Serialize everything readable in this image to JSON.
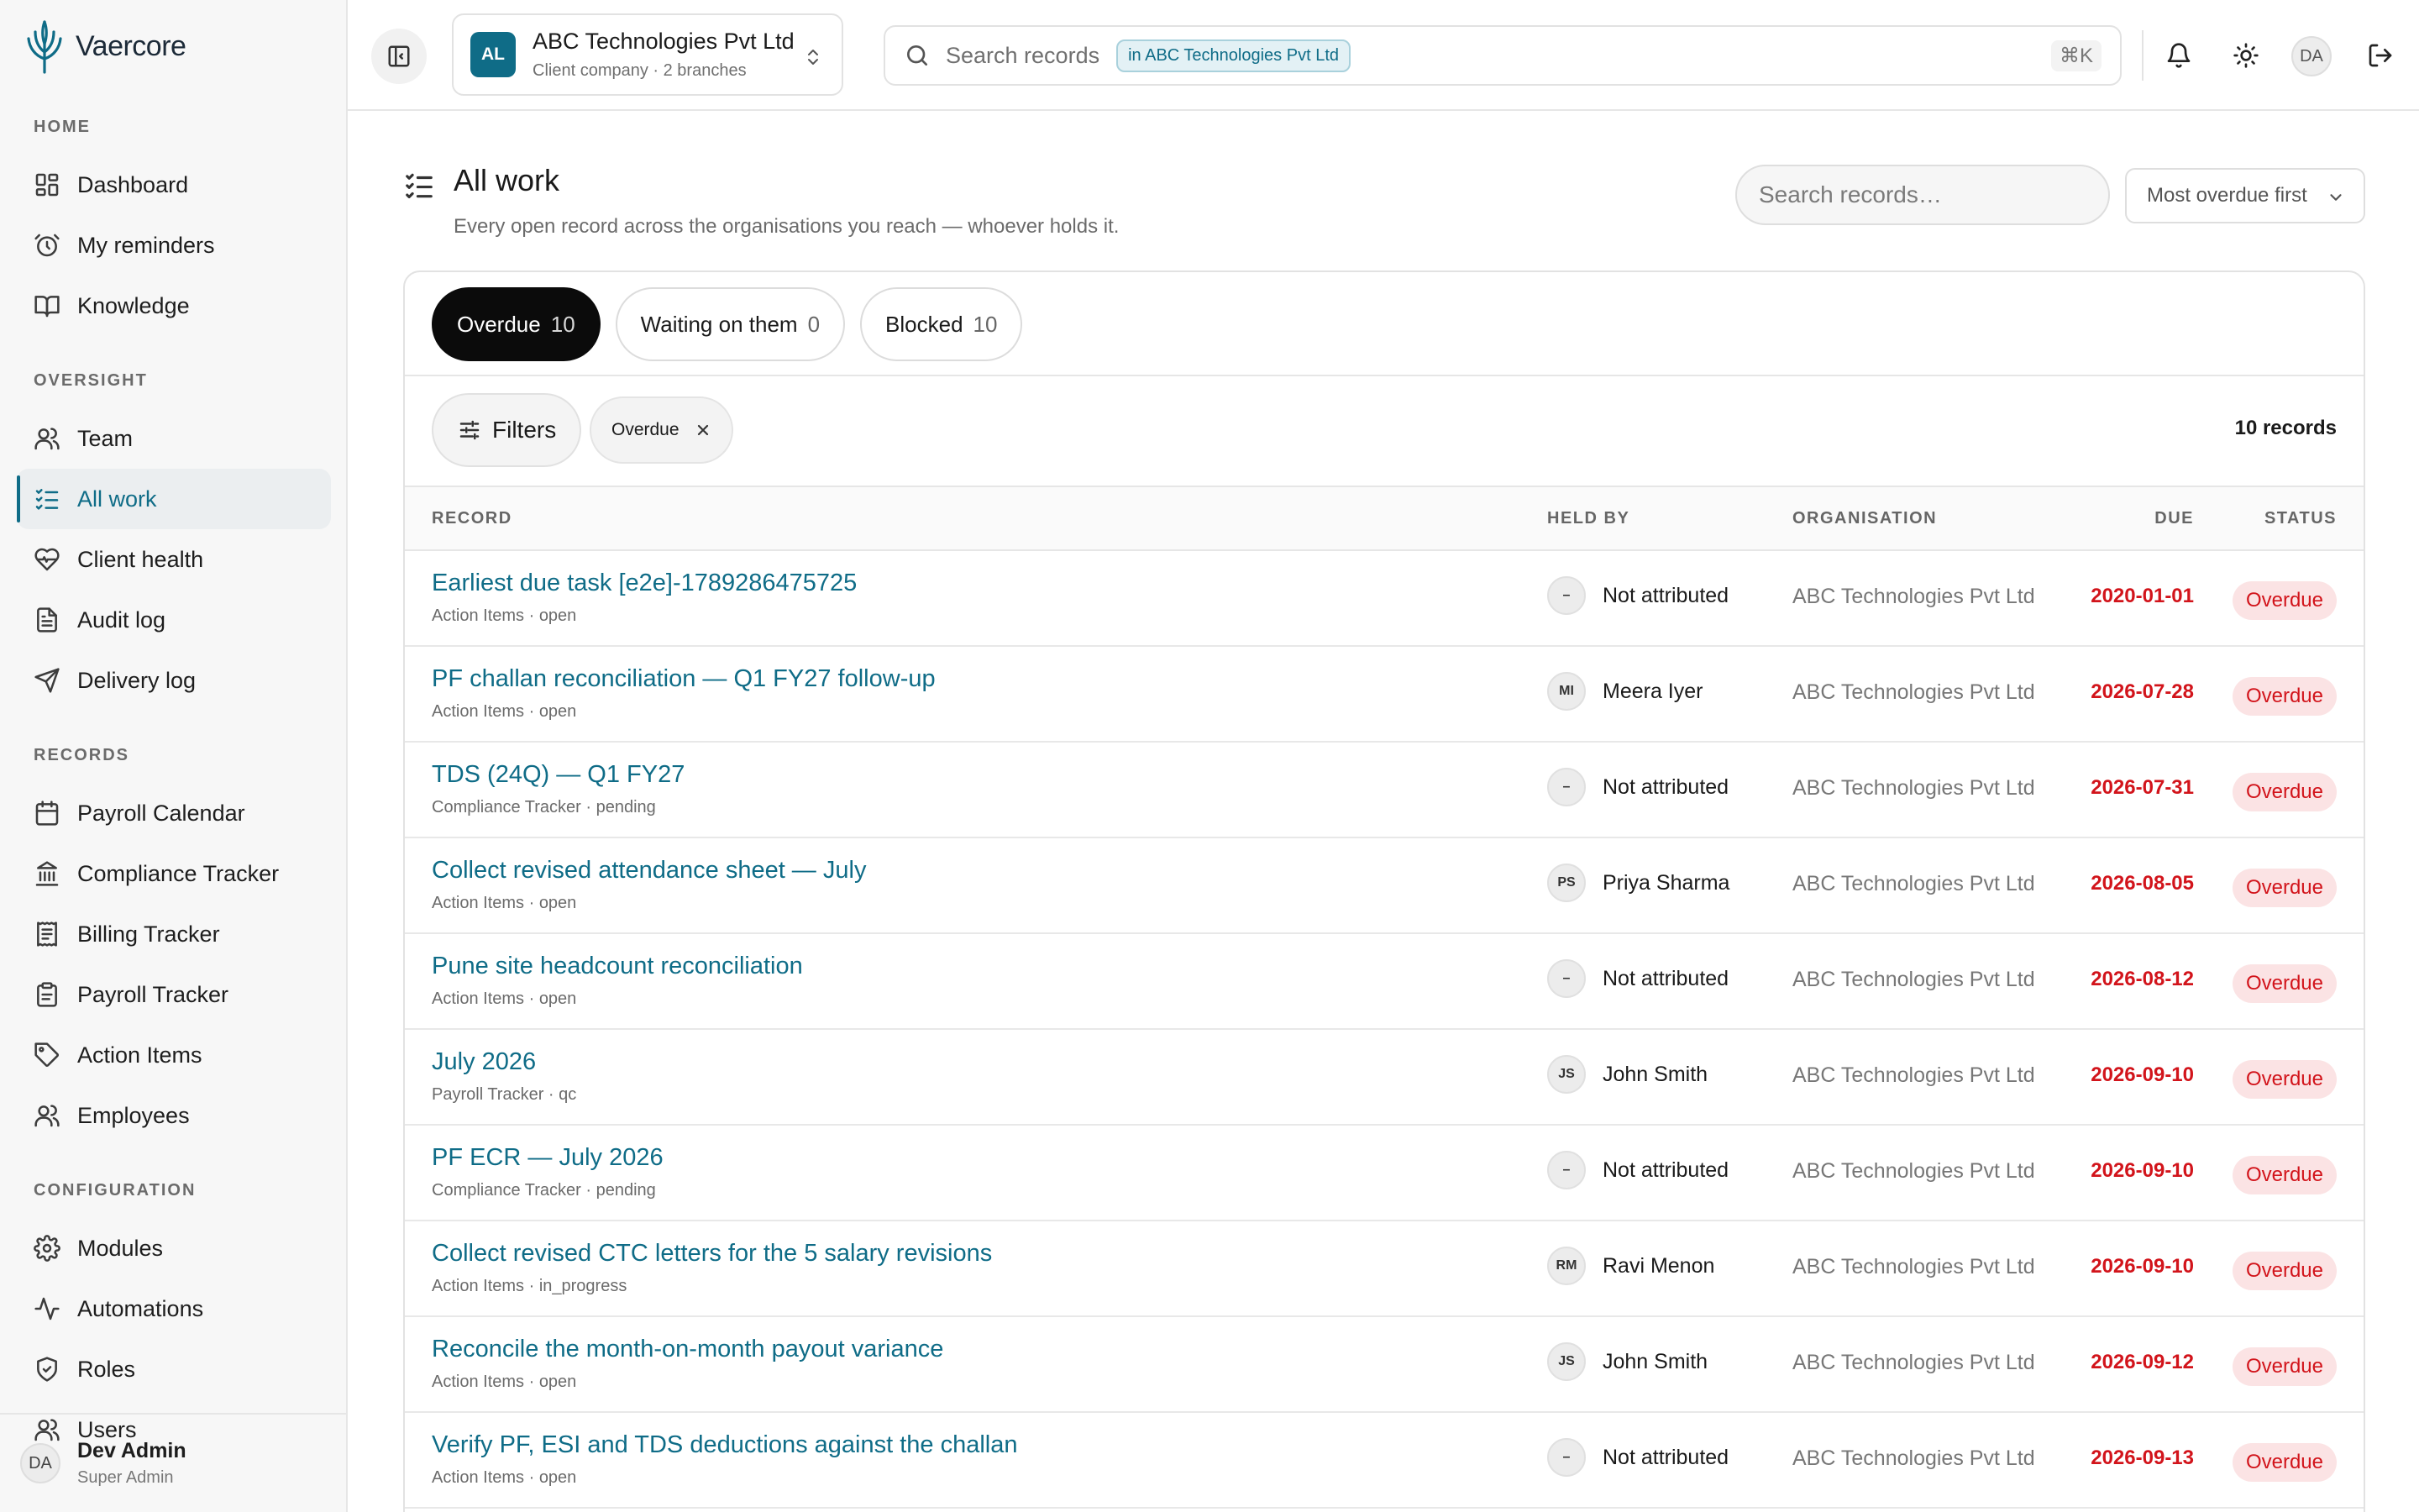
{
  "app": {
    "name": "Vaercore"
  },
  "sidebar": {
    "sections": [
      {
        "heading": "HOME",
        "items": [
          {
            "label": "Dashboard",
            "icon": "dashboard-icon"
          },
          {
            "label": "My reminders",
            "icon": "alarm-icon"
          },
          {
            "label": "Knowledge",
            "icon": "book-icon"
          }
        ]
      },
      {
        "heading": "OVERSIGHT",
        "items": [
          {
            "label": "Team",
            "icon": "users-icon"
          },
          {
            "label": "All work",
            "icon": "list-check-icon",
            "active": true
          },
          {
            "label": "Client health",
            "icon": "heart-pulse-icon"
          },
          {
            "label": "Audit log",
            "icon": "file-text-icon"
          },
          {
            "label": "Delivery log",
            "icon": "send-icon"
          }
        ]
      },
      {
        "heading": "RECORDS",
        "items": [
          {
            "label": "Payroll Calendar",
            "icon": "calendar-icon"
          },
          {
            "label": "Compliance Tracker",
            "icon": "landmark-icon"
          },
          {
            "label": "Billing Tracker",
            "icon": "receipt-icon"
          },
          {
            "label": "Payroll Tracker",
            "icon": "clipboard-icon"
          },
          {
            "label": "Action Items",
            "icon": "tag-icon"
          },
          {
            "label": "Employees",
            "icon": "users-icon"
          }
        ]
      },
      {
        "heading": "CONFIGURATION",
        "items": [
          {
            "label": "Modules",
            "icon": "gear-icon"
          },
          {
            "label": "Automations",
            "icon": "activity-icon"
          },
          {
            "label": "Roles",
            "icon": "shield-icon"
          },
          {
            "label": "Users",
            "icon": "users-icon"
          }
        ]
      }
    ],
    "user": {
      "initials": "DA",
      "name": "Dev Admin",
      "role": "Super Admin"
    }
  },
  "topbar": {
    "company": {
      "badge": "AL",
      "name": "ABC Technologies Pvt Ltd",
      "sub": "Client company · 2 branches"
    },
    "search": {
      "placeholder": "Search records",
      "scope": "in ABC Technologies Pvt Ltd",
      "shortcut": "⌘K"
    },
    "user_initials": "DA"
  },
  "page": {
    "title": "All work",
    "subtitle": "Every open record across the organisations you reach — whoever holds it.",
    "search_placeholder": "Search records…",
    "sort_label": "Most overdue first"
  },
  "tabs": [
    {
      "label": "Overdue",
      "count": "10",
      "active": true
    },
    {
      "label": "Waiting on them",
      "count": "0"
    },
    {
      "label": "Blocked",
      "count": "10"
    }
  ],
  "filters": {
    "button": "Filters",
    "active_chip": "Overdue",
    "record_count": "10 records"
  },
  "table": {
    "columns": {
      "record": "RECORD",
      "held_by": "HELD BY",
      "organisation": "ORGANISATION",
      "due": "DUE",
      "status": "STATUS"
    },
    "rows": [
      {
        "title": "Earliest due task [e2e]-1789286475725",
        "meta": "Action Items · open",
        "holder_initials": "–",
        "holder": "Not attributed",
        "org": "ABC Technologies Pvt Ltd",
        "due": "2020-01-01",
        "status": "Overdue"
      },
      {
        "title": "PF challan reconciliation — Q1 FY27 follow-up",
        "meta": "Action Items · open",
        "holder_initials": "MI",
        "holder": "Meera Iyer",
        "org": "ABC Technologies Pvt Ltd",
        "due": "2026-07-28",
        "status": "Overdue"
      },
      {
        "title": "TDS (24Q) — Q1 FY27",
        "meta": "Compliance Tracker · pending",
        "holder_initials": "–",
        "holder": "Not attributed",
        "org": "ABC Technologies Pvt Ltd",
        "due": "2026-07-31",
        "status": "Overdue"
      },
      {
        "title": "Collect revised attendance sheet — July",
        "meta": "Action Items · open",
        "holder_initials": "PS",
        "holder": "Priya Sharma",
        "org": "ABC Technologies Pvt Ltd",
        "due": "2026-08-05",
        "status": "Overdue"
      },
      {
        "title": "Pune site headcount reconciliation",
        "meta": "Action Items · open",
        "holder_initials": "–",
        "holder": "Not attributed",
        "org": "ABC Technologies Pvt Ltd",
        "due": "2026-08-12",
        "status": "Overdue"
      },
      {
        "title": "July 2026",
        "meta": "Payroll Tracker · qc",
        "holder_initials": "JS",
        "holder": "John Smith",
        "org": "ABC Technologies Pvt Ltd",
        "due": "2026-09-10",
        "status": "Overdue"
      },
      {
        "title": "PF ECR — July 2026",
        "meta": "Compliance Tracker · pending",
        "holder_initials": "–",
        "holder": "Not attributed",
        "org": "ABC Technologies Pvt Ltd",
        "due": "2026-09-10",
        "status": "Overdue"
      },
      {
        "title": "Collect revised CTC letters for the 5 salary revisions",
        "meta": "Action Items · in_progress",
        "holder_initials": "RM",
        "holder": "Ravi Menon",
        "org": "ABC Technologies Pvt Ltd",
        "due": "2026-09-10",
        "status": "Overdue"
      },
      {
        "title": "Reconcile the month-on-month payout variance",
        "meta": "Action Items · open",
        "holder_initials": "JS",
        "holder": "John Smith",
        "org": "ABC Technologies Pvt Ltd",
        "due": "2026-09-12",
        "status": "Overdue"
      },
      {
        "title": "Verify PF, ESI and TDS deductions against the challan",
        "meta": "Action Items · open",
        "holder_initials": "–",
        "holder": "Not attributed",
        "org": "ABC Technologies Pvt Ltd",
        "due": "2026-09-13",
        "status": "Overdue"
      }
    ]
  },
  "colors": {
    "accent": "#0f6c87",
    "overdue": "#d2141b",
    "overdue_bg": "#fbe3e4"
  }
}
